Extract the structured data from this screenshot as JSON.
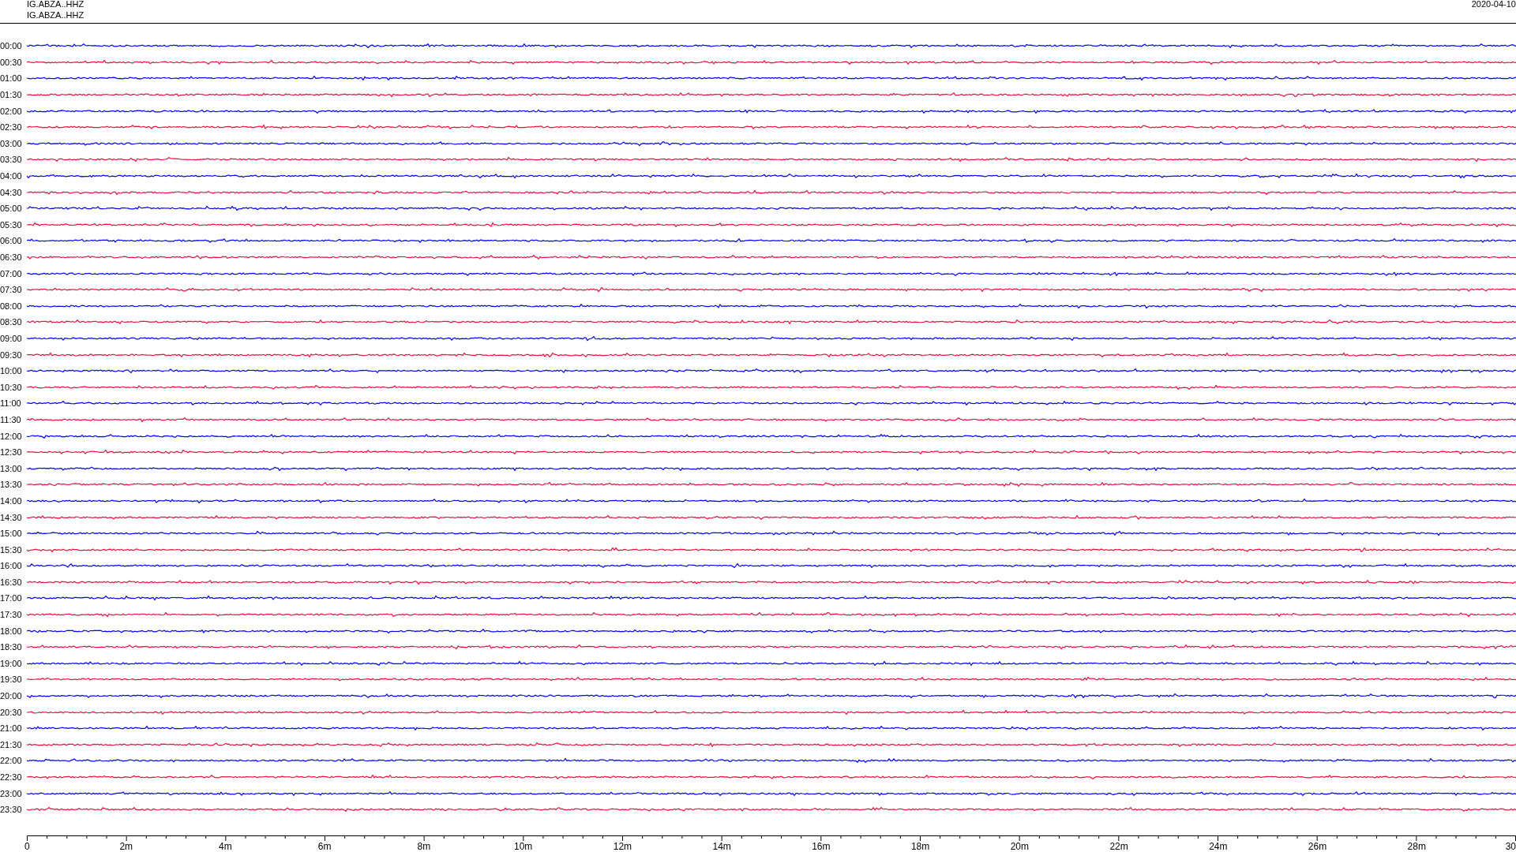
{
  "header": {
    "title_lines": [
      "IG.ABZA..HHZ",
      "IG.ABZA..HHZ"
    ],
    "date": "2020-04-10"
  },
  "rows": [
    {
      "label": "00:00",
      "color": "#0000ff"
    },
    {
      "label": "00:30",
      "color": "#e8123c"
    },
    {
      "label": "01:00",
      "color": "#0000ff"
    },
    {
      "label": "01:30",
      "color": "#e8123c"
    },
    {
      "label": "02:00",
      "color": "#0000ff"
    },
    {
      "label": "02:30",
      "color": "#e8123c"
    },
    {
      "label": "03:00",
      "color": "#0000ff"
    },
    {
      "label": "03:30",
      "color": "#e8123c"
    },
    {
      "label": "04:00",
      "color": "#0000ff"
    },
    {
      "label": "04:30",
      "color": "#e8123c"
    },
    {
      "label": "05:00",
      "color": "#0000ff"
    },
    {
      "label": "05:30",
      "color": "#e8123c"
    },
    {
      "label": "06:00",
      "color": "#0000ff"
    },
    {
      "label": "06:30",
      "color": "#e8123c"
    },
    {
      "label": "07:00",
      "color": "#0000ff"
    },
    {
      "label": "07:30",
      "color": "#e8123c"
    },
    {
      "label": "08:00",
      "color": "#0000ff"
    },
    {
      "label": "08:30",
      "color": "#e8123c"
    },
    {
      "label": "09:00",
      "color": "#0000ff"
    },
    {
      "label": "09:30",
      "color": "#e8123c"
    },
    {
      "label": "10:00",
      "color": "#0000ff"
    },
    {
      "label": "10:30",
      "color": "#e8123c"
    },
    {
      "label": "11:00",
      "color": "#0000ff"
    },
    {
      "label": "11:30",
      "color": "#e8123c"
    },
    {
      "label": "12:00",
      "color": "#0000ff"
    },
    {
      "label": "12:30",
      "color": "#e8123c"
    },
    {
      "label": "13:00",
      "color": "#0000ff"
    },
    {
      "label": "13:30",
      "color": "#e8123c"
    },
    {
      "label": "14:00",
      "color": "#0000ff"
    },
    {
      "label": "14:30",
      "color": "#e8123c"
    },
    {
      "label": "15:00",
      "color": "#0000ff"
    },
    {
      "label": "15:30",
      "color": "#e8123c"
    },
    {
      "label": "16:00",
      "color": "#0000ff"
    },
    {
      "label": "16:30",
      "color": "#e8123c"
    },
    {
      "label": "17:00",
      "color": "#0000ff"
    },
    {
      "label": "17:30",
      "color": "#e8123c"
    },
    {
      "label": "18:00",
      "color": "#0000ff"
    },
    {
      "label": "18:30",
      "color": "#e8123c"
    },
    {
      "label": "19:00",
      "color": "#0000ff"
    },
    {
      "label": "19:30",
      "color": "#e8123c"
    },
    {
      "label": "20:00",
      "color": "#0000ff"
    },
    {
      "label": "20:30",
      "color": "#e8123c"
    },
    {
      "label": "21:00",
      "color": "#0000ff"
    },
    {
      "label": "21:30",
      "color": "#e8123c"
    },
    {
      "label": "22:00",
      "color": "#0000ff"
    },
    {
      "label": "22:30",
      "color": "#e8123c"
    },
    {
      "label": "23:00",
      "color": "#0000ff"
    },
    {
      "label": "23:30",
      "color": "#e8123c"
    }
  ],
  "x_axis": {
    "tick_labels": [
      "0",
      "2m",
      "4m",
      "6m",
      "8m",
      "10m",
      "12m",
      "14m",
      "16m",
      "18m",
      "20m",
      "22m",
      "24m",
      "26m",
      "28m",
      "30"
    ]
  }
}
